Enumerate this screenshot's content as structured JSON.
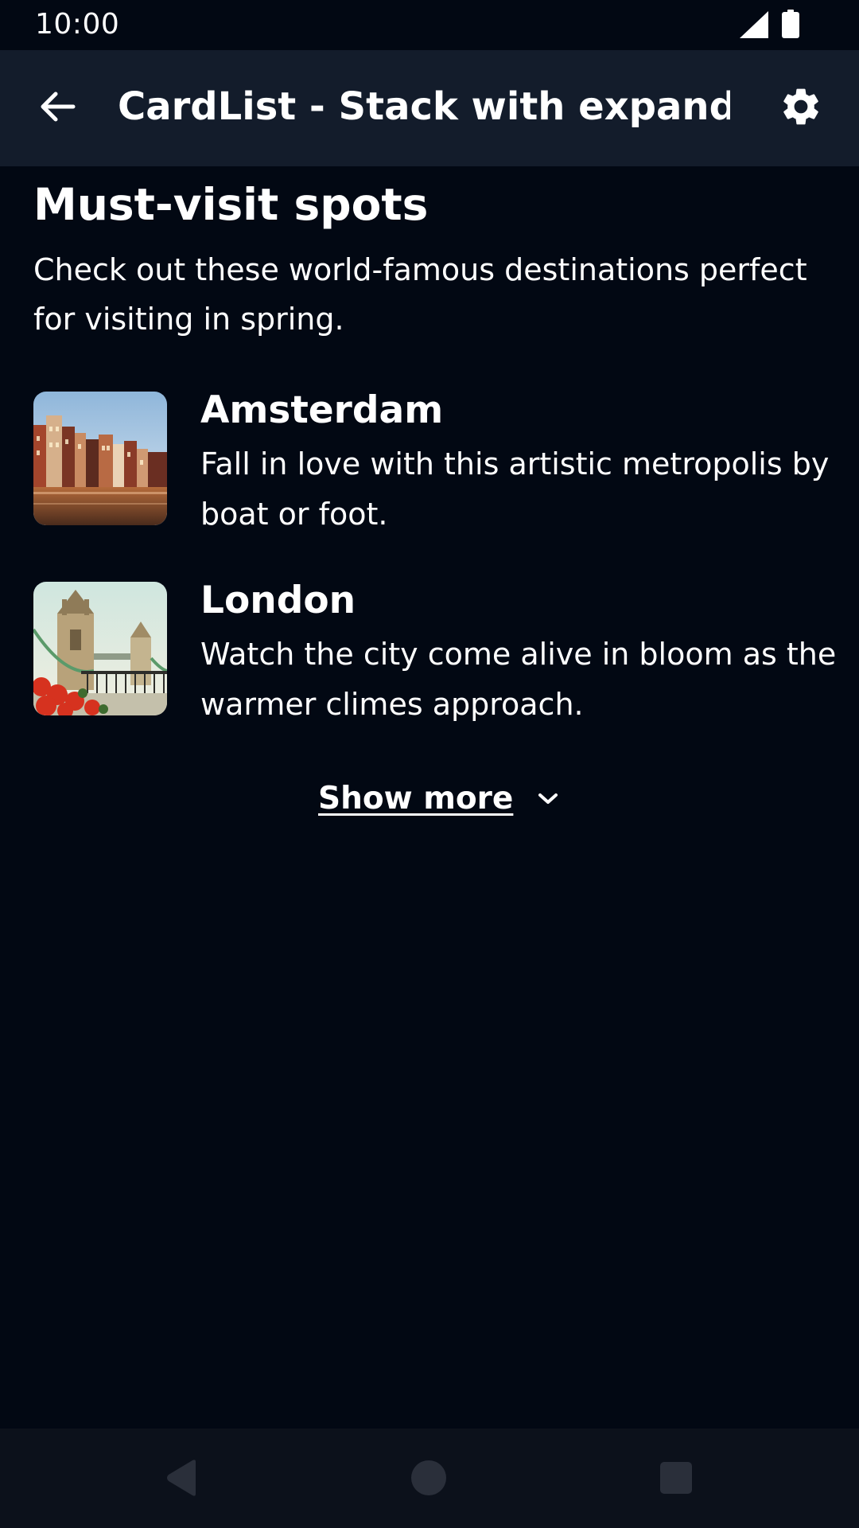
{
  "status_bar": {
    "time": "10:00"
  },
  "app_bar": {
    "title": "CardList - Stack with expand a...",
    "back_icon": "arrow-back-icon",
    "settings_icon": "gear-icon"
  },
  "section": {
    "title": "Must-visit spots",
    "description": "Check out these world-famous destinations perfect for visiting in spring."
  },
  "items": [
    {
      "title": "Amsterdam",
      "description": "Fall in love with this artistic metropolis by boat or foot.",
      "image": "amsterdam-canal-houses-photo"
    },
    {
      "title": "London",
      "description": "Watch the city come alive in bloom as the warmer climes approach.",
      "image": "london-tower-bridge-photo"
    }
  ],
  "show_more": {
    "label": "Show more",
    "icon": "chevron-down-icon"
  },
  "nav_bar": {
    "back_icon": "triangle-back-icon",
    "home_icon": "circle-home-icon",
    "recents_icon": "square-recents-icon"
  },
  "colors": {
    "background": "#020813",
    "app_bar": "#131c2b",
    "nav_bar": "#0c111b",
    "text": "#ffffff"
  }
}
